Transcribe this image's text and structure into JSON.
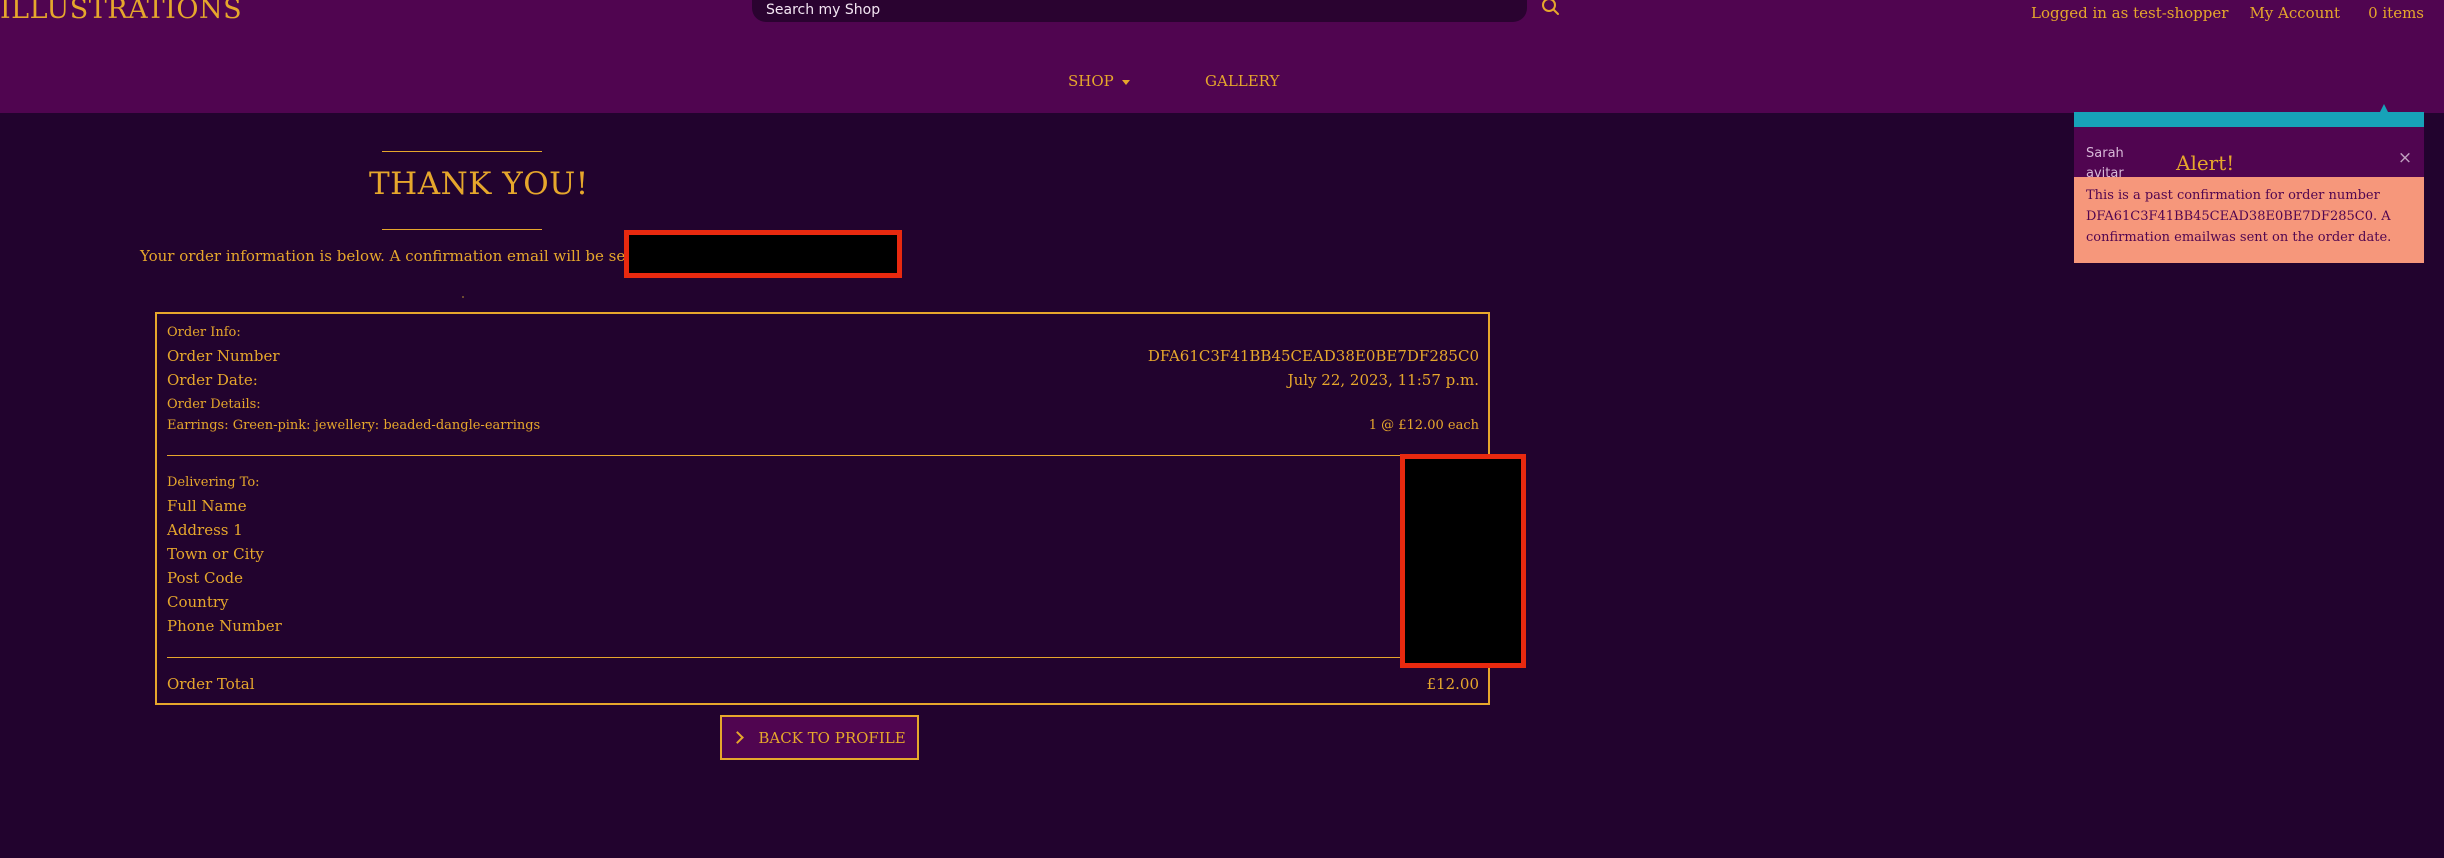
{
  "header": {
    "brand": "ILLUSTRATIONS",
    "search_placeholder": "Search my Shop",
    "logged_in": "Logged in as test-shopper",
    "my_account": "My Account",
    "cart": "0 items"
  },
  "nav": {
    "shop": "SHOP",
    "gallery": "GALLERY"
  },
  "page": {
    "title": "THANK YOU!",
    "intro": "Your order information is below. A confirmation email will be sent to"
  },
  "order": {
    "info_label": "Order Info:",
    "number_label": "Order Number",
    "number_value": "DFA61C3F41BB45CEAD38E0BE7DF285C0",
    "date_label": "Order Date:",
    "date_value": "July 22, 2023, 11:57 p.m.",
    "details_label": "Order Details:",
    "item_name": "Earrings: Green-pink: jewellery: beaded-dangle-earrings",
    "item_qty_price": "1 @ £12.00 each",
    "delivery_label": "Delivering To:",
    "delivery_fields": [
      "Full Name",
      "Address 1",
      "Town or City",
      "Post Code",
      "Country",
      "Phone Number"
    ],
    "total_label": "Order Total",
    "total_value": "£12.00"
  },
  "actions": {
    "back_to_profile": "BACK TO PROFILE"
  },
  "toast": {
    "avatar_alt": "Sarah avitar",
    "title": "Alert!",
    "close": "×",
    "message": "This is a past confirmation for order number DFA61C3F41BB45CEAD38E0BE7DF285C0. A confirmation emailwas sent on the order date."
  },
  "colors": {
    "header_bg": "#500550",
    "page_bg": "#22032e",
    "accent_gold": "#e6a72c",
    "toast_bar": "#17a2b8",
    "toast_body": "#f6977b",
    "redaction_border": "#e8290f"
  }
}
